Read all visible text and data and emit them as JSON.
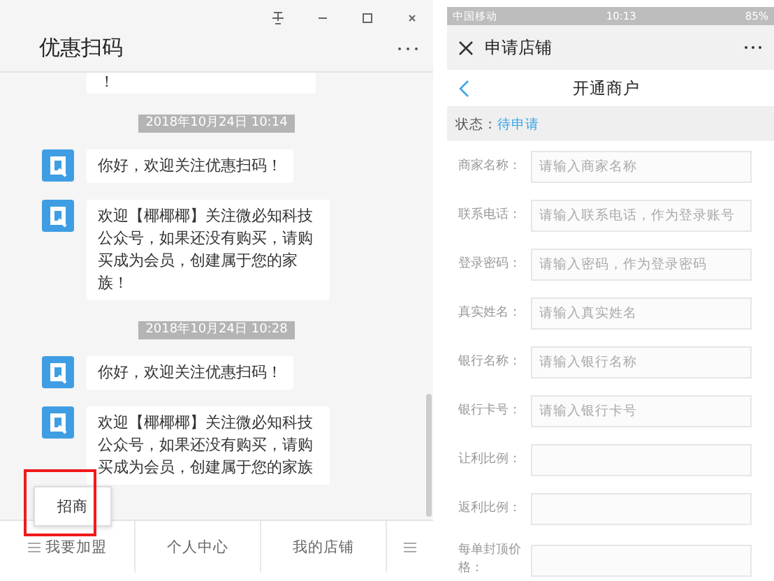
{
  "window": {
    "title": "优惠扫码"
  },
  "chat": [
    {
      "kind": "fragment",
      "text": "！"
    },
    {
      "kind": "time",
      "text": "2018年10月24日 10:14"
    },
    {
      "kind": "message",
      "text": "你好，欢迎关注优惠扫码！"
    },
    {
      "kind": "message",
      "text": "欢迎【椰椰椰】关注微必知科技公众号，如果还没有购买，请购买成为会员，创建属于您的家族！"
    },
    {
      "kind": "time",
      "text": "2018年10月24日 10:28"
    },
    {
      "kind": "message",
      "text": "你好，欢迎关注优惠扫码！"
    },
    {
      "kind": "message",
      "text": "欢迎【椰椰椰】关注微必知科技公众号，如果还没有购买，请购买成为会员，创建属于您的家族"
    }
  ],
  "popup_menu": {
    "items": [
      "招商"
    ]
  },
  "bottom_menu": [
    {
      "kind": "menu",
      "label": "我要加盟"
    },
    {
      "kind": "plain",
      "label": "个人中心"
    },
    {
      "kind": "plain",
      "label": "我的店铺"
    },
    {
      "kind": "icon"
    }
  ],
  "phone": {
    "status_bar": {
      "carrier": "中国移动",
      "time": "10:13",
      "battery": "85%"
    },
    "nav": {
      "title": "申请店铺"
    },
    "page_title": "开通商户",
    "status": {
      "label": "状态：",
      "value": "待申请"
    },
    "fields": [
      {
        "label": "商家名称：",
        "placeholder": "请输入商家名称"
      },
      {
        "label": "联系电话：",
        "placeholder": "请输入联系电话，作为登录账号"
      },
      {
        "label": "登录密码：",
        "placeholder": "请输入密码，作为登录密码"
      },
      {
        "label": "真实姓名：",
        "placeholder": "请输入真实姓名"
      },
      {
        "label": "银行名称：",
        "placeholder": "请输入银行名称"
      },
      {
        "label": "银行卡号：",
        "placeholder": "请输入银行卡号"
      },
      {
        "label": "让利比例："
      },
      {
        "label": "返利比例："
      },
      {
        "label": "每单封顶价格："
      }
    ]
  }
}
